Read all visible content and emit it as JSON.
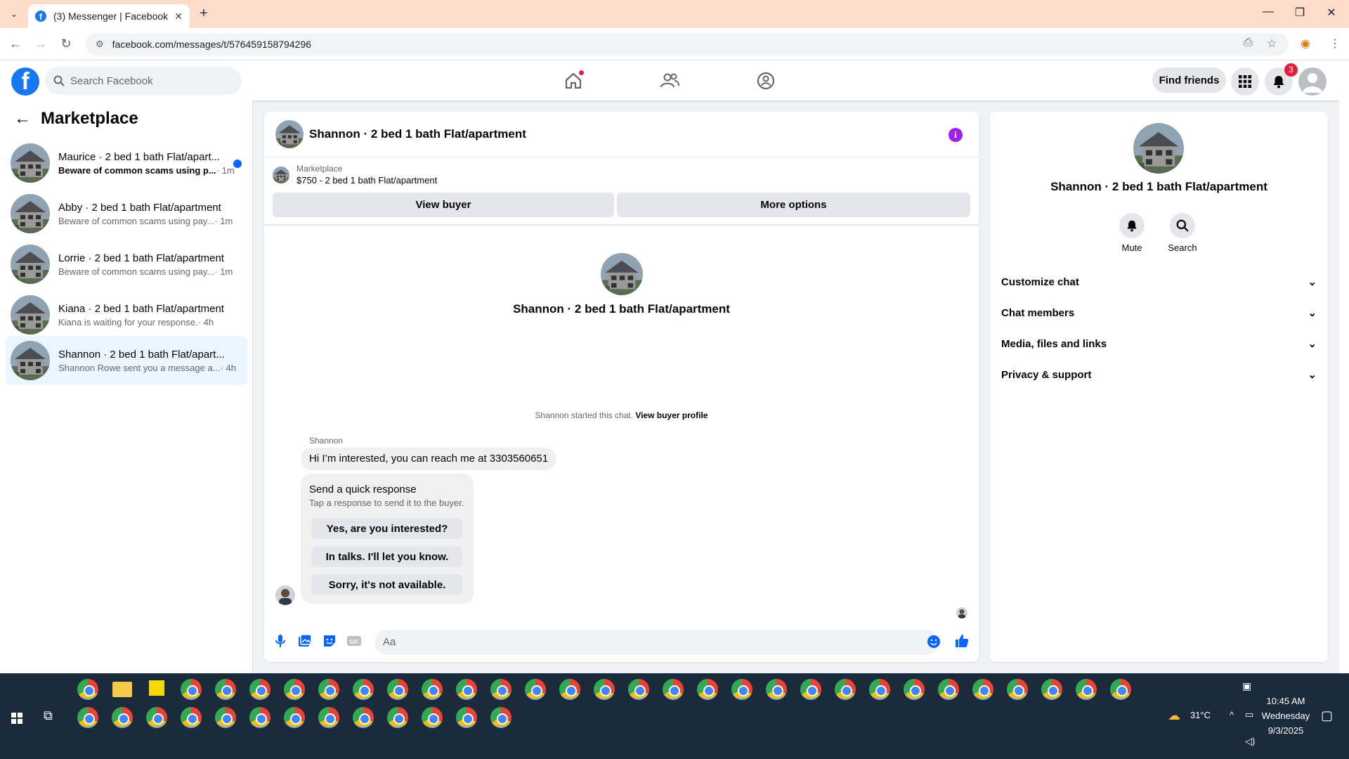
{
  "browser": {
    "tab_title": "(3) Messenger | Facebook",
    "url": "facebook.com/messages/t/576459158794296"
  },
  "fb": {
    "search_placeholder": "Search Facebook",
    "find_friends": "Find friends",
    "notification_count": "3"
  },
  "sidebar": {
    "title": "Marketplace",
    "conversations": [
      {
        "name": "Maurice · 2 bed 1 bath Flat/apart...",
        "preview": "Beware of common scams using p...",
        "time": "· 1m",
        "unread": true
      },
      {
        "name": "Abby · 2 bed 1 bath Flat/apartment",
        "preview": "Beware of common scams using pay...",
        "time": "· 1m",
        "unread": false
      },
      {
        "name": "Lorrie · 2 bed 1 bath Flat/apartment",
        "preview": "Beware of common scams using pay...",
        "time": "· 1m",
        "unread": false
      },
      {
        "name": "Kiana · 2 bed 1 bath Flat/apartment",
        "preview": "Kiana is waiting for your response.",
        "time": "· 4h",
        "unread": false
      },
      {
        "name": "Shannon · 2 bed 1 bath Flat/apart...",
        "preview": "Shannon Rowe sent you a message a...",
        "time": "· 4h",
        "unread": false,
        "active": true
      }
    ]
  },
  "chat": {
    "title": "Shannon · 2 bed 1 bath Flat/apartment",
    "marketplace_label": "Marketplace",
    "listing": "$750 - 2 bed 1 bath Flat/apartment",
    "view_buyer": "View buyer",
    "more_options": "More options",
    "center_name": "Shannon · 2 bed 1 bath Flat/apartment",
    "started_text": "Shannon started this chat.",
    "view_profile": "View buyer profile",
    "sender": "Shannon",
    "message": "Hi I’m interested, you can reach me at 3303560651",
    "quick_title": "Send a quick response",
    "quick_sub": "Tap a response to send it to the buyer.",
    "quick_replies": [
      "Yes, are you interested?",
      "In talks. I'll let you know.",
      "Sorry, it's not available."
    ],
    "input_placeholder": "Aa"
  },
  "details": {
    "name": "Shannon · 2 bed 1 bath Flat/apartment",
    "mute": "Mute",
    "search": "Search",
    "sections": [
      "Customize chat",
      "Chat members",
      "Media, files and links",
      "Privacy & support"
    ]
  },
  "taskbar": {
    "temperature": "31°C",
    "time": "10:45 AM",
    "day": "Wednesday",
    "date": "9/3/2025"
  },
  "colors": {
    "facebook_blue": "#1877f2",
    "unread_dot": "#0866ff",
    "info_purple": "#a020f0",
    "badge_red": "#e41e3f",
    "active_conversation": "#ebf5ff",
    "taskbar": "#1c2b3c"
  }
}
